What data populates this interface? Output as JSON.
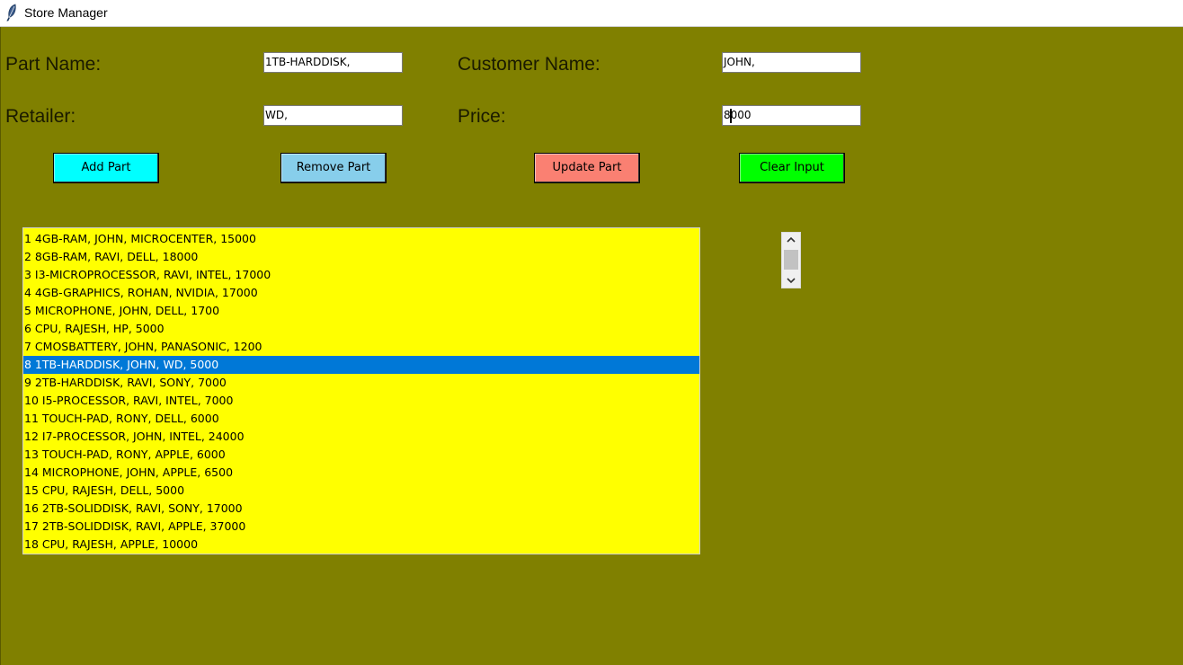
{
  "window": {
    "title": "Store Manager",
    "icon": "feather-icon",
    "background_color": "#808000"
  },
  "form": {
    "part_name_label": "Part Name:",
    "part_name_value": "1TB-HARDDISK,",
    "customer_name_label": "Customer Name:",
    "customer_name_value": "JOHN,",
    "retailer_label": "Retailer:",
    "retailer_value": "WD,",
    "price_label": "Price:",
    "price_value_before_caret": "8",
    "price_value_after_caret": "000"
  },
  "buttons": {
    "add": {
      "label": "Add Part",
      "color": "#00ffff"
    },
    "remove": {
      "label": "Remove Part",
      "color": "#87ceeb"
    },
    "update": {
      "label": "Update Part",
      "color": "#fa8072"
    },
    "clear": {
      "label": "Clear Input",
      "color": "#00ff00"
    }
  },
  "parts_list": {
    "background_color": "#ffff00",
    "selected_color": "#0078d7",
    "selected_index": 7,
    "items": [
      "1 4GB-RAM, JOHN, MICROCENTER, 15000",
      "2 8GB-RAM, RAVI, DELL, 18000",
      "3 I3-MICROPROCESSOR, RAVI, INTEL, 17000",
      "4 4GB-GRAPHICS, ROHAN, NVIDIA, 17000",
      "5 MICROPHONE, JOHN, DELL, 1700",
      "6 CPU, RAJESH, HP, 5000",
      "7 CMOSBATTERY, JOHN, PANASONIC, 1200",
      "8 1TB-HARDDISK, JOHN, WD, 5000",
      "9 2TB-HARDDISK, RAVI, SONY, 7000",
      "10 I5-PROCESSOR, RAVI, INTEL, 7000",
      "11 TOUCH-PAD, RONY, DELL, 6000",
      "12 I7-PROCESSOR, JOHN, INTEL, 24000",
      "13 TOUCH-PAD, RONY, APPLE, 6000",
      "14 MICROPHONE, JOHN, APPLE, 6500",
      "15 CPU, RAJESH, DELL, 5000",
      "16 2TB-SOLIDDISK, RAVI, SONY, 17000",
      "17 2TB-SOLIDDISK, RAVI, APPLE, 37000",
      "18 CPU, RAJESH, APPLE, 10000"
    ]
  },
  "scrollbar": {
    "up_icon": "chevron-up-icon",
    "down_icon": "chevron-down-icon"
  }
}
